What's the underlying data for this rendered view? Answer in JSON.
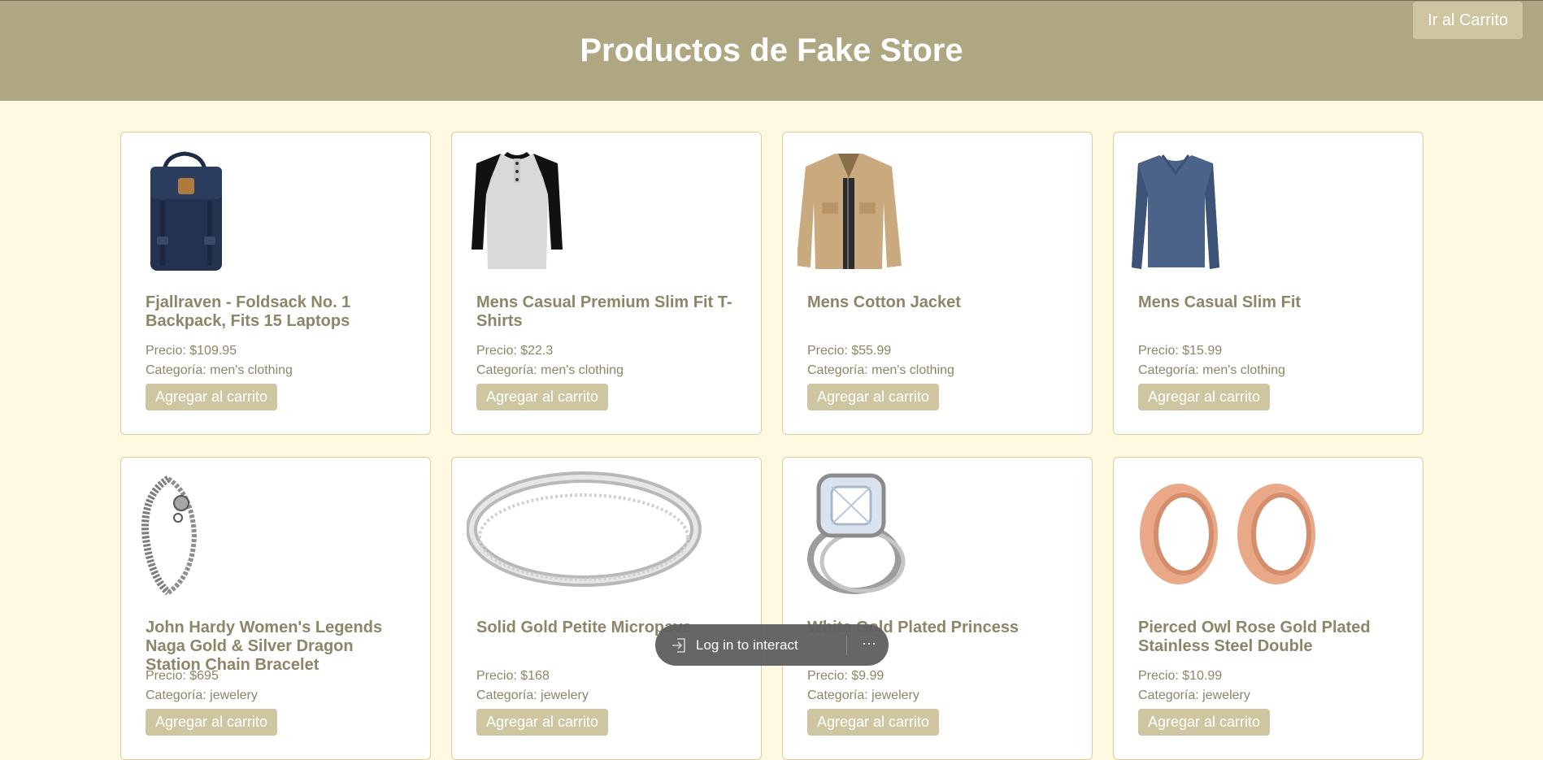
{
  "header": {
    "title": "Productos de Fake Store",
    "cart_button": "Ir al Carrito"
  },
  "products": [
    {
      "title": "Fjallraven - Foldsack No. 1 Backpack, Fits 15 Laptops",
      "price": "Precio: $109.95",
      "category": "Categoría: men's clothing",
      "button": "Agregar al carrito",
      "image_icon": "backpack-icon"
    },
    {
      "title": "Mens Casual Premium Slim Fit T-Shirts",
      "price": "Precio: $22.3",
      "category": "Categoría: men's clothing",
      "button": "Agregar al carrito",
      "image_icon": "tshirt-icon"
    },
    {
      "title": "Mens Cotton Jacket",
      "price": "Precio: $55.99",
      "category": "Categoría: men's clothing",
      "button": "Agregar al carrito",
      "image_icon": "jacket-icon"
    },
    {
      "title": "Mens Casual Slim Fit",
      "price": "Precio: $15.99",
      "category": "Categoría: men's clothing",
      "button": "Agregar al carrito",
      "image_icon": "longsleeve-icon"
    },
    {
      "title": "John Hardy Women's Legends Naga Gold & Silver Dragon Station Chain Bracelet",
      "price": "Precio: $695",
      "category": "Categoría: jewelery",
      "button": "Agregar al carrito",
      "image_icon": "bracelet-icon"
    },
    {
      "title": "Solid Gold Petite Micropave",
      "price": "Precio: $168",
      "category": "Categoría: jewelery",
      "button": "Agregar al carrito",
      "image_icon": "ring-band-icon"
    },
    {
      "title": "White Gold Plated Princess",
      "price": "Precio: $9.99",
      "category": "Categoría: jewelery",
      "button": "Agregar al carrito",
      "image_icon": "diamond-ring-icon"
    },
    {
      "title": "Pierced Owl Rose Gold Plated Stainless Steel Double",
      "price": "Precio: $10.99",
      "category": "Categoría: jewelery",
      "button": "Agregar al carrito",
      "image_icon": "earring-tunnels-icon"
    }
  ],
  "overlay": {
    "login_label": "Log in to interact",
    "more_label": "···"
  },
  "colors": {
    "header_bg": "#aea782",
    "page_bg": "#fff9e1",
    "button_bg": "#cec6a0",
    "text": "#8d8567",
    "card_border": "#d8cf9d"
  }
}
